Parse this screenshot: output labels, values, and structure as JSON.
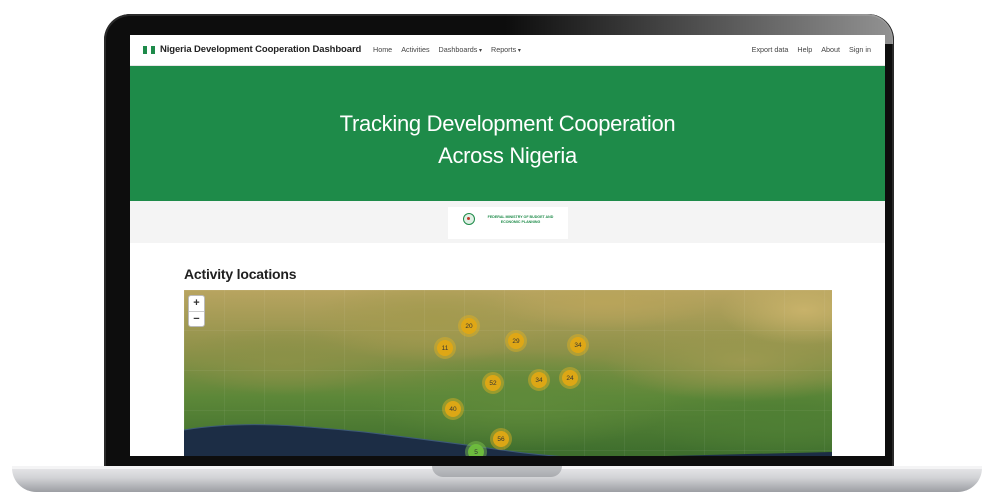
{
  "nav": {
    "brand": "Nigeria Development Cooperation Dashboard",
    "links": [
      "Home",
      "Activities",
      "Dashboards",
      "Reports"
    ],
    "right_links": [
      "Export data",
      "Help",
      "About",
      "Sign in"
    ]
  },
  "hero": {
    "title_line1": "Tracking Development Cooperation",
    "title_line2": "Across Nigeria"
  },
  "logo": {
    "text_line1": "FEDERAL MINISTRY OF BUDGET AND",
    "text_line2": "ECONOMIC PLANNING"
  },
  "section": {
    "title": "Activity locations"
  },
  "map": {
    "zoom_in": "+",
    "zoom_out": "−",
    "clusters": [
      "20",
      "11",
      "29",
      "34",
      "52",
      "34",
      "24",
      "40",
      "56",
      "5"
    ]
  },
  "colors": {
    "brand_green": "#1e8b49",
    "cluster_yellow": "#e0a814",
    "cluster_green": "#6ebe3c"
  }
}
